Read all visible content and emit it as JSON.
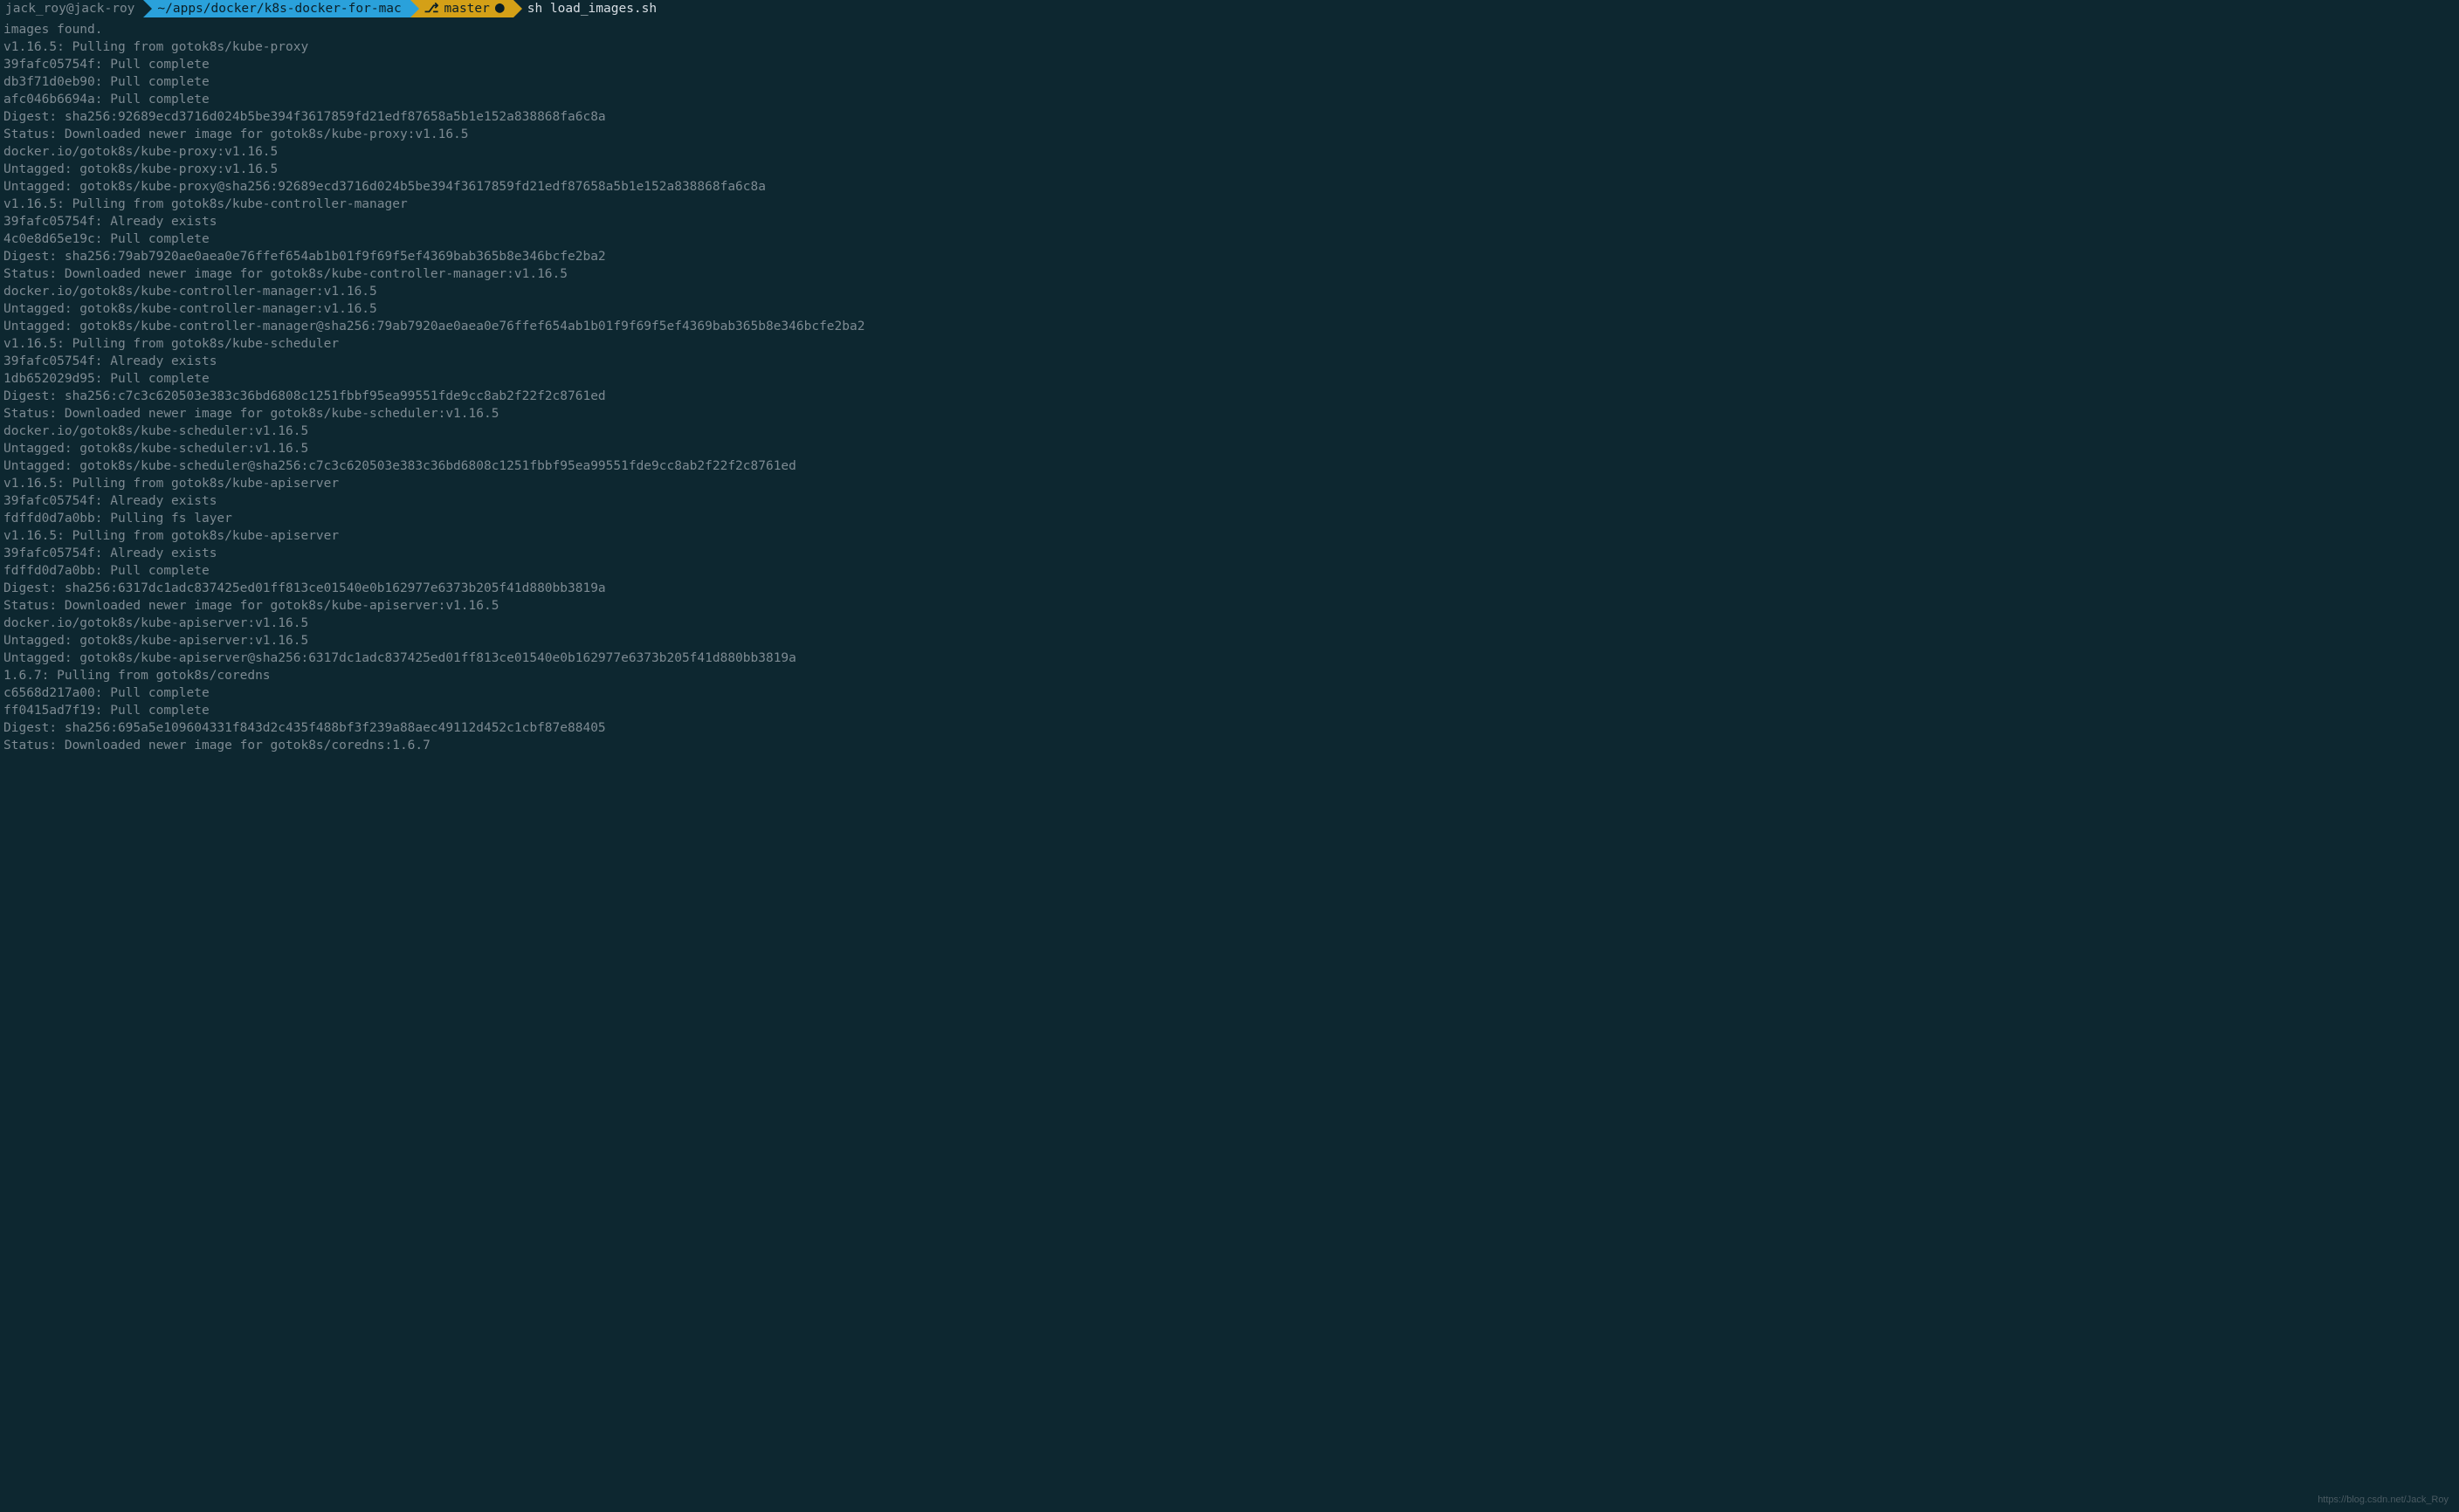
{
  "prompt": {
    "user": "jack_roy@jack-roy",
    "path": "~/apps/docker/k8s-docker-for-mac",
    "branch_icon": "⎇",
    "branch": "master",
    "branch_dirty": "●",
    "command": "sh load_images.sh"
  },
  "output_lines": [
    "images found.",
    "v1.16.5: Pulling from gotok8s/kube-proxy",
    "39fafc05754f: Pull complete",
    "db3f71d0eb90: Pull complete",
    "afc046b6694a: Pull complete",
    "Digest: sha256:92689ecd3716d024b5be394f3617859fd21edf87658a5b1e152a838868fa6c8a",
    "Status: Downloaded newer image for gotok8s/kube-proxy:v1.16.5",
    "docker.io/gotok8s/kube-proxy:v1.16.5",
    "Untagged: gotok8s/kube-proxy:v1.16.5",
    "Untagged: gotok8s/kube-proxy@sha256:92689ecd3716d024b5be394f3617859fd21edf87658a5b1e152a838868fa6c8a",
    "v1.16.5: Pulling from gotok8s/kube-controller-manager",
    "39fafc05754f: Already exists",
    "4c0e8d65e19c: Pull complete",
    "Digest: sha256:79ab7920ae0aea0e76ffef654ab1b01f9f69f5ef4369bab365b8e346bcfe2ba2",
    "Status: Downloaded newer image for gotok8s/kube-controller-manager:v1.16.5",
    "docker.io/gotok8s/kube-controller-manager:v1.16.5",
    "Untagged: gotok8s/kube-controller-manager:v1.16.5",
    "Untagged: gotok8s/kube-controller-manager@sha256:79ab7920ae0aea0e76ffef654ab1b01f9f69f5ef4369bab365b8e346bcfe2ba2",
    "v1.16.5: Pulling from gotok8s/kube-scheduler",
    "39fafc05754f: Already exists",
    "1db652029d95: Pull complete",
    "Digest: sha256:c7c3c620503e383c36bd6808c1251fbbf95ea99551fde9cc8ab2f22f2c8761ed",
    "Status: Downloaded newer image for gotok8s/kube-scheduler:v1.16.5",
    "docker.io/gotok8s/kube-scheduler:v1.16.5",
    "Untagged: gotok8s/kube-scheduler:v1.16.5",
    "Untagged: gotok8s/kube-scheduler@sha256:c7c3c620503e383c36bd6808c1251fbbf95ea99551fde9cc8ab2f22f2c8761ed",
    "v1.16.5: Pulling from gotok8s/kube-apiserver",
    "39fafc05754f: Already exists",
    "fdffd0d7a0bb: Pulling fs layer",
    "v1.16.5: Pulling from gotok8s/kube-apiserver",
    "39fafc05754f: Already exists",
    "fdffd0d7a0bb: Pull complete",
    "Digest: sha256:6317dc1adc837425ed01ff813ce01540e0b162977e6373b205f41d880bb3819a",
    "Status: Downloaded newer image for gotok8s/kube-apiserver:v1.16.5",
    "docker.io/gotok8s/kube-apiserver:v1.16.5",
    "Untagged: gotok8s/kube-apiserver:v1.16.5",
    "Untagged: gotok8s/kube-apiserver@sha256:6317dc1adc837425ed01ff813ce01540e0b162977e6373b205f41d880bb3819a",
    "1.6.7: Pulling from gotok8s/coredns",
    "c6568d217a00: Pull complete",
    "ff0415ad7f19: Pull complete",
    "Digest: sha256:695a5e109604331f843d2c435f488bf3f239a88aec49112d452c1cbf87e88405",
    "Status: Downloaded newer image for gotok8s/coredns:1.6.7"
  ],
  "watermark": "https://blog.csdn.net/Jack_Roy"
}
